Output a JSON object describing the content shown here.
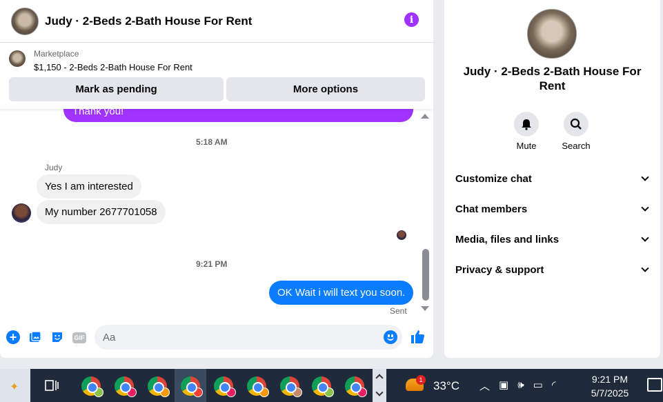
{
  "header": {
    "title": "Judy · 2-Beds 2-Bath House For Rent",
    "info_icon": "info-icon"
  },
  "marketplace": {
    "label": "Marketplace",
    "listing": "$1,150 - 2-Beds 2-Bath House For Rent",
    "mark_pending_label": "Mark as pending",
    "more_options_label": "More options"
  },
  "messages": {
    "partial_outgoing": "Thank you!",
    "time_1": "5:18 AM",
    "sender": "Judy",
    "incoming_1": "Yes I am interested",
    "incoming_2": "My number 2677701058",
    "time_2": "9:21 PM",
    "outgoing_1": "OK Wait i will text you soon.",
    "status": "Sent"
  },
  "composer": {
    "placeholder": "Aa"
  },
  "info_panel": {
    "title": "Judy · 2-Beds 2-Bath House For Rent",
    "mute_label": "Mute",
    "search_label": "Search",
    "sections": [
      "Customize chat",
      "Chat members",
      "Media, files and links",
      "Privacy & support"
    ]
  },
  "taskbar": {
    "weather_badge": "1",
    "temperature": "33°C",
    "time": "9:21 PM",
    "date": "5/7/2025"
  },
  "colors": {
    "accent_purple": "#a033ff",
    "messenger_blue": "#0a7cff",
    "taskbar": "#1f2a3a"
  }
}
